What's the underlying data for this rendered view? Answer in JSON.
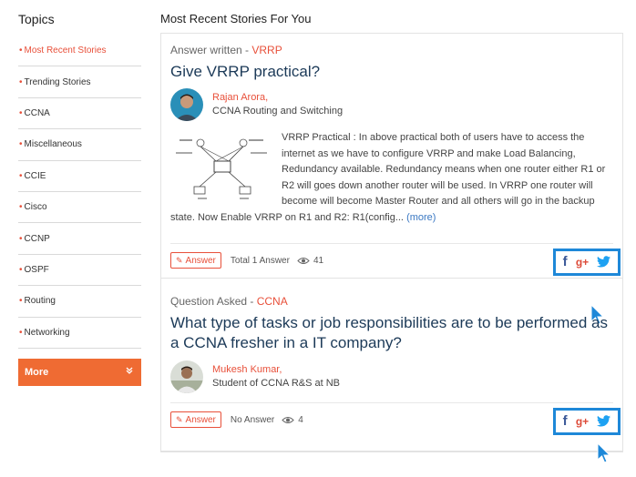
{
  "sidebar": {
    "title": "Topics",
    "topics": [
      {
        "label": "Most Recent Stories",
        "active": true
      },
      {
        "label": "Trending Stories"
      },
      {
        "label": "CCNA"
      },
      {
        "label": "Miscellaneous"
      },
      {
        "label": "CCIE"
      },
      {
        "label": "Cisco"
      },
      {
        "label": "CCNP"
      },
      {
        "label": "OSPF"
      },
      {
        "label": "Routing"
      },
      {
        "label": "Networking"
      }
    ],
    "more_label": "More",
    "more_icon": "»"
  },
  "main": {
    "title": "Most Recent Stories For You",
    "stories": [
      {
        "type_prefix": "Answer written - ",
        "category": "VRRP",
        "title": "Give VRRP practical?",
        "author_name": "Rajan Arora,",
        "author_role": "CCNA Routing and Switching",
        "excerpt": "VRRP Practical :    In above practical both of users have to access the internet as we have to configure VRRP and make Load Balancing, Redundancy available. Redundancy means when one router either R1 or R2 will goes down another router will be used. In VRRP one router will become will become Master Router and all others will go in the backup state. Now Enable VRRP on R1 and R2: R1(config...",
        "more_link": "(more)",
        "answer_label": "Answer",
        "answer_count": "Total 1 Answer",
        "views": "41"
      },
      {
        "type_prefix": "Question Asked - ",
        "category": "CCNA",
        "title": "What type of tasks or job responsibilities are to be performed as a CCNA fresher in a IT company?",
        "author_name": "Mukesh Kumar,",
        "author_role": "Student of CCNA R&S at NB",
        "answer_label": "Answer",
        "answer_count": "No Answer",
        "views": "4"
      }
    ]
  },
  "share": {
    "facebook": "f",
    "googleplus": "g+"
  },
  "colors": {
    "accent": "#e8503a",
    "more_button": "#ef6b33",
    "title_blue": "#1c3a58",
    "highlight_blue": "#1e88d8"
  },
  "icons": [
    "pencil-icon",
    "eye-icon",
    "facebook-icon",
    "google-plus-icon",
    "twitter-icon",
    "cursor-icon",
    "double-chevron-down-icon"
  ]
}
